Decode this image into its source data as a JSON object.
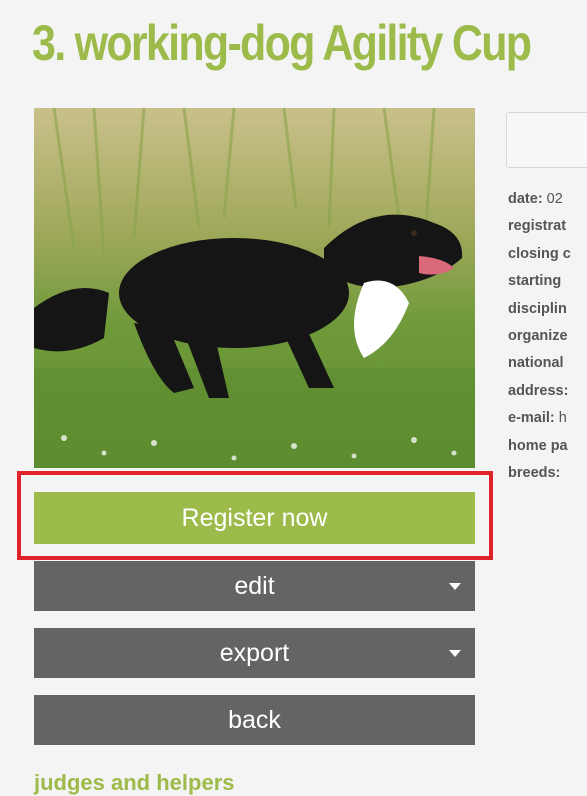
{
  "header": {
    "title": "3. working-dog Agility Cup"
  },
  "actions": {
    "register_label": "Register now",
    "edit_label": "edit",
    "export_label": "export",
    "back_label": "back"
  },
  "section": {
    "heading": "judges and helpers"
  },
  "details": [
    {
      "label": "date:",
      "value": " 02"
    },
    {
      "label": "registrat",
      "value": ""
    },
    {
      "label": "closing c",
      "value": ""
    },
    {
      "label": "starting",
      "value": ""
    },
    {
      "label": "disciplin",
      "value": ""
    },
    {
      "label": "organize",
      "value": ""
    },
    {
      "label": "national",
      "value": ""
    },
    {
      "label": "address:",
      "value": ""
    },
    {
      "label": "e-mail:",
      "value": " h"
    },
    {
      "label": "home pa",
      "value": ""
    },
    {
      "label": "breeds:",
      "value": ""
    }
  ],
  "colors": {
    "accent": "#9cbb4a",
    "button_grey": "#646464",
    "highlight": "#e0232a",
    "background": "#f4f4f4"
  },
  "icons": {
    "dropdown": "caret-down-icon"
  },
  "image": {
    "subject": "border-collie-running-photo"
  }
}
